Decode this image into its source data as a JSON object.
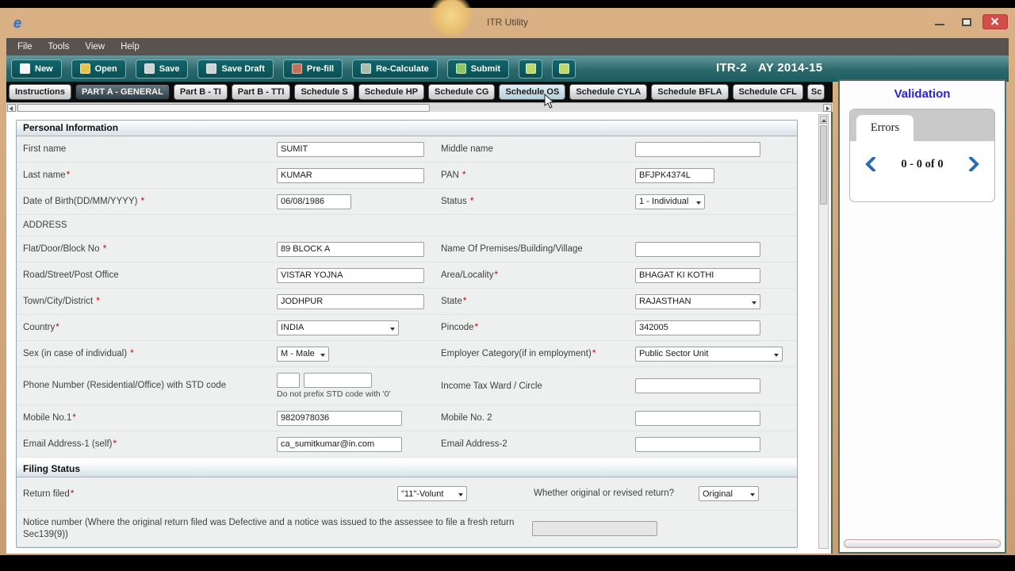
{
  "window": {
    "title": "ITR Utility",
    "app_icon_glyph": "e"
  },
  "menu": {
    "items": [
      "File",
      "Tools",
      "View",
      "Help"
    ]
  },
  "toolbar": {
    "buttons": [
      {
        "label": "New",
        "icon": "new-file-icon"
      },
      {
        "label": "Open",
        "icon": "open-folder-icon"
      },
      {
        "label": "Save",
        "icon": "save-icon"
      },
      {
        "label": "Save Draft",
        "icon": "save-draft-icon"
      },
      {
        "label": "Pre-fill",
        "icon": "pre-fill-icon"
      },
      {
        "label": "Re-Calculate",
        "icon": "re-calculate-icon"
      },
      {
        "label": "Submit",
        "icon": "submit-icon"
      }
    ],
    "form_name": "ITR-2",
    "assessment_year": "AY 2014-15"
  },
  "tabs": [
    {
      "label": "Instructions"
    },
    {
      "label": "PART A - GENERAL"
    },
    {
      "label": "Part B - TI"
    },
    {
      "label": "Part B - TTI"
    },
    {
      "label": "Schedule S"
    },
    {
      "label": "Schedule HP"
    },
    {
      "label": "Schedule CG"
    },
    {
      "label": "Schedule OS"
    },
    {
      "label": "Schedule CYLA"
    },
    {
      "label": "Schedule BFLA"
    },
    {
      "label": "Schedule CFL"
    },
    {
      "label": "Sc"
    }
  ],
  "form": {
    "personal_header": "Personal Information",
    "address_header": "ADDRESS",
    "filing_header": "Filing Status",
    "phone_hint": "Do not prefix STD code with '0'",
    "rows": [
      {
        "left_label": "First name",
        "left_req": "",
        "left_value": "SUMIT",
        "right_label": "Middle name",
        "right_req": "",
        "right_value": ""
      },
      {
        "left_label": "Last name",
        "left_req": "*",
        "left_value": "KUMAR",
        "right_label": "PAN ",
        "right_req": "*",
        "right_value": "BFJPK4374L"
      },
      {
        "left_label": "Date of Birth(DD/MM/YYYY) ",
        "left_req": "*",
        "left_value": "06/08/1986",
        "right_label": "Status ",
        "right_req": "*",
        "right_value": "1 - Individual"
      },
      {
        "left_label": "Flat/Door/Block No ",
        "left_req": "*",
        "left_value": "89 BLOCK A",
        "right_label": "Name Of Premises/Building/Village",
        "right_req": "",
        "right_value": ""
      },
      {
        "left_label": "Road/Street/Post Office",
        "left_req": "",
        "left_value": "VISTAR YOJNA",
        "right_label": "Area/Locality",
        "right_req": "*",
        "right_value": "BHAGAT KI KOTHI"
      },
      {
        "left_label": "Town/City/District ",
        "left_req": "*",
        "left_value": "JODHPUR",
        "right_label": "State",
        "right_req": "*",
        "right_value": "RAJASTHAN"
      },
      {
        "left_label": "Country",
        "left_req": "*",
        "left_value": "INDIA",
        "right_label": "Pincode",
        "right_req": "*",
        "right_value": "342005"
      },
      {
        "left_label": "Sex (in case of individual) ",
        "left_req": "*",
        "left_value": "M - Male",
        "right_label": "Employer Category(if in employment)",
        "right_req": "*",
        "right_value": "Public Sector Unit"
      },
      {
        "left_label": "Phone Number (Residential/Office) with STD code",
        "left_req": "",
        "std_value": "",
        "phone_value": "",
        "right_label": "Income Tax Ward / Circle",
        "right_req": "",
        "right_value": ""
      },
      {
        "left_label": "Mobile No.1",
        "left_req": "*",
        "left_value": "9820978036",
        "right_label": "Mobile No. 2",
        "right_req": "",
        "right_value": ""
      },
      {
        "left_label": "Email Address-1 (self)",
        "left_req": "*",
        "left_value": "ca_sumitkumar@in.com",
        "right_label": "Email Address-2",
        "right_req": "",
        "right_value": ""
      }
    ],
    "filing": {
      "return_filed_label": "Return filed",
      "return_filed_req": "*",
      "return_filed_value": "\"11\"-Volunt",
      "revised_label": "Whether original or revised return?",
      "revised_value": "Original",
      "notice_label": "Notice number (Where the original return filed was Defective and a notice was issued to the assessee to file a fresh return Sec139(9))",
      "notice_value": ""
    }
  },
  "validation": {
    "title": "Validation",
    "errors_tab": "Errors",
    "pager": "0 - 0 of 0"
  }
}
